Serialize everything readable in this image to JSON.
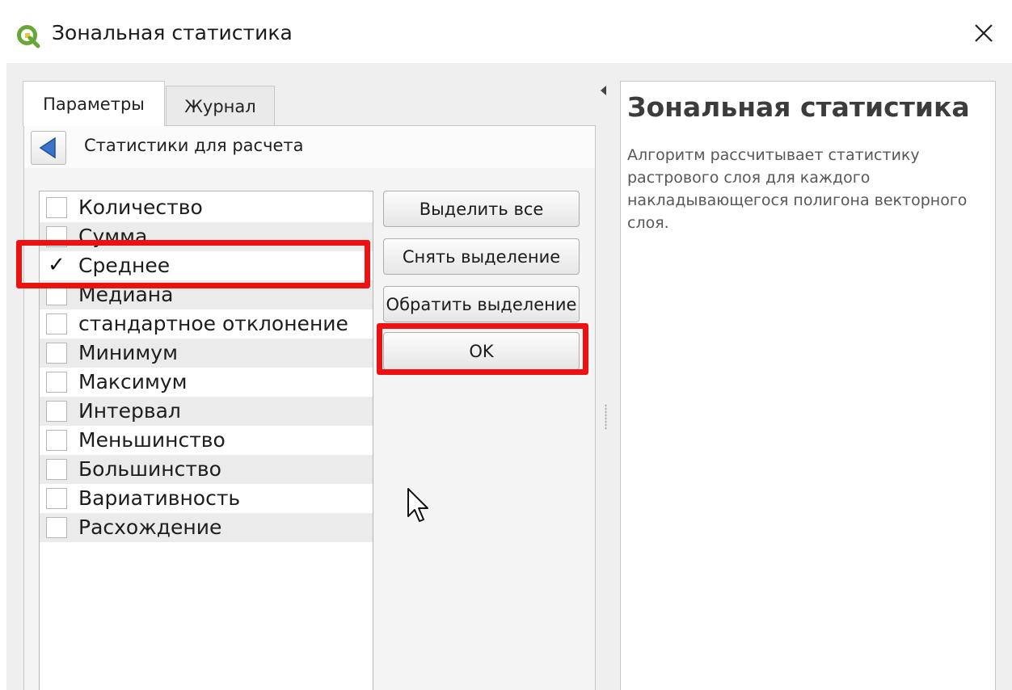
{
  "window": {
    "title": "Зональная статистика",
    "icon": "qgis-logo-icon",
    "close_icon": "close-icon"
  },
  "tabs": [
    {
      "label": "Параметры",
      "active": true
    },
    {
      "label": "Журнал",
      "active": false
    }
  ],
  "panel": {
    "back_icon": "back-arrow-icon",
    "title": "Статистики для расчета"
  },
  "statistics": [
    {
      "label": "Количество",
      "checked": false
    },
    {
      "label": "Сумма",
      "checked": false
    },
    {
      "label": "Среднее",
      "checked": true
    },
    {
      "label": "Медиана",
      "checked": false
    },
    {
      "label": "стандартное отклонение",
      "checked": false
    },
    {
      "label": "Минимум",
      "checked": false
    },
    {
      "label": "Максимум",
      "checked": false
    },
    {
      "label": "Интервал",
      "checked": false
    },
    {
      "label": "Меньшинство",
      "checked": false
    },
    {
      "label": "Большинство",
      "checked": false
    },
    {
      "label": "Вариативность",
      "checked": false
    },
    {
      "label": "Расхождение",
      "checked": false
    }
  ],
  "buttons": {
    "select_all": "Выделить все",
    "deselect": "Снять выделение",
    "invert": "Обратить выделение",
    "ok": "OK"
  },
  "help": {
    "title": "Зональная статистика",
    "description": "Алгоритм рассчитывает статистику растрового слоя для каждого накладывающегося полигона векторного слоя."
  },
  "colors": {
    "highlight": "#ee1111",
    "qgis_green": "#6aa53a"
  }
}
